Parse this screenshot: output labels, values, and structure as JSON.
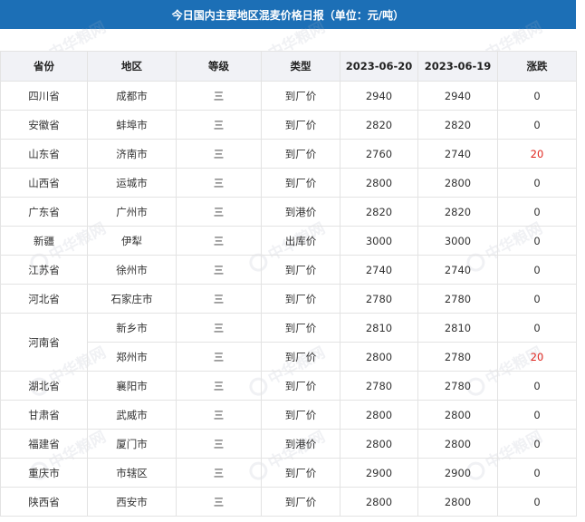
{
  "title": "今日国内主要地区混麦价格日报（单位：元/吨）",
  "watermark": "中华粮网",
  "colors": {
    "header_bg": "#1c6fb6",
    "table_head_bg": "#f1f2f6",
    "increase": "#e0261e"
  },
  "headers": [
    "省份",
    "地区",
    "等级",
    "类型",
    "2023-06-20",
    "2023-06-19",
    "涨跌"
  ],
  "rows": [
    [
      "四川省",
      "成都市",
      "三",
      "到厂价",
      "2940",
      "2940",
      "0"
    ],
    [
      "安徽省",
      "蚌埠市",
      "三",
      "到厂价",
      "2820",
      "2820",
      "0"
    ],
    [
      "山东省",
      "济南市",
      "三",
      "到厂价",
      "2760",
      "2740",
      "20"
    ],
    [
      "山西省",
      "运城市",
      "三",
      "到厂价",
      "2800",
      "2800",
      "0"
    ],
    [
      "广东省",
      "广州市",
      "三",
      "到港价",
      "2820",
      "2820",
      "0"
    ],
    [
      "新疆",
      "伊犁",
      "三",
      "出库价",
      "3000",
      "3000",
      "0"
    ],
    [
      "江苏省",
      "徐州市",
      "三",
      "到厂价",
      "2740",
      "2740",
      "0"
    ],
    [
      "河北省",
      "石家庄市",
      "三",
      "到厂价",
      "2780",
      "2780",
      "0"
    ],
    [
      "河南省",
      "新乡市",
      "三",
      "到厂价",
      "2810",
      "2810",
      "0"
    ],
    [
      "",
      "郑州市",
      "三",
      "到厂价",
      "2800",
      "2780",
      "20"
    ],
    [
      "湖北省",
      "襄阳市",
      "三",
      "到厂价",
      "2780",
      "2780",
      "0"
    ],
    [
      "甘肃省",
      "武威市",
      "三",
      "到厂价",
      "2800",
      "2800",
      "0"
    ],
    [
      "福建省",
      "厦门市",
      "三",
      "到港价",
      "2800",
      "2800",
      "0"
    ],
    [
      "重庆市",
      "市辖区",
      "三",
      "到厂价",
      "2900",
      "2900",
      "0"
    ],
    [
      "陕西省",
      "西安市",
      "三",
      "到厂价",
      "2800",
      "2800",
      "0"
    ]
  ]
}
